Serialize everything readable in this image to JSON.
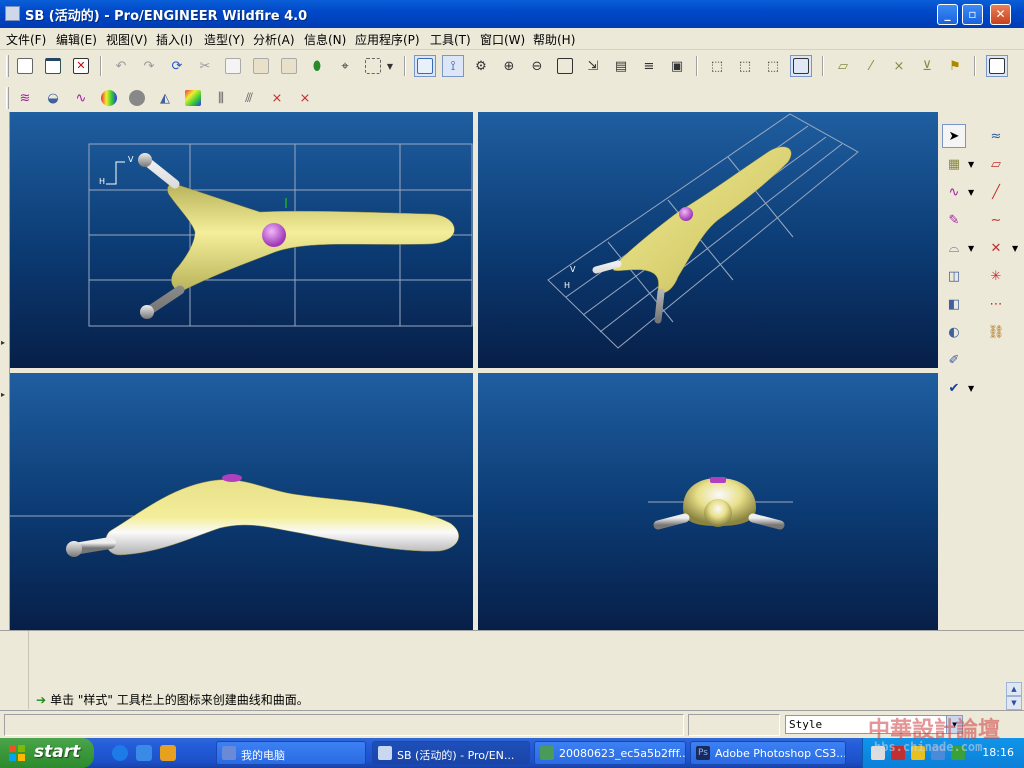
{
  "window": {
    "title": "SB (活动的) - Pro/ENGINEER Wildfire 4.0",
    "buttons": {
      "minimize": "_",
      "maximize": "▫",
      "close": "✕"
    }
  },
  "menu": [
    "文件(F)",
    "编辑(E)",
    "视图(V)",
    "插入(I)",
    "造型(Y)",
    "分析(A)",
    "信息(N)",
    "应用程序(P)",
    "工具(T)",
    "窗口(W)",
    "帮助(H)"
  ],
  "viewports": {
    "top_left": {
      "axis_label_a": "V",
      "axis_label_b": "H"
    },
    "top_right": {
      "axis_label_a": "V",
      "axis_label_b": "H"
    }
  },
  "message": "单击 \"样式\" 工具栏上的图标来创建曲线和曲面。",
  "statusbar": {
    "style_value": "Style"
  },
  "taskbar": {
    "start_label": "start",
    "tasks": [
      {
        "label": "我的电脑",
        "active": false
      },
      {
        "label": "SB (活动的) - Pro/EN...",
        "active": true
      },
      {
        "label": "20080623_ec5a5b2fff...",
        "active": false
      },
      {
        "label": "Adobe Photoshop CS3...",
        "active": false
      }
    ],
    "clock": "18:16"
  },
  "watermark": {
    "title": "中華設計論壇",
    "subtitle": "bbs.chinade.com"
  },
  "colors": {
    "model_fill": "#e8e08a",
    "model_shade": "#c8c060",
    "datum_lines": "#9aa8c0",
    "viewport_bg_top": "#1f5ea0",
    "viewport_bg_bottom": "#071f48"
  }
}
